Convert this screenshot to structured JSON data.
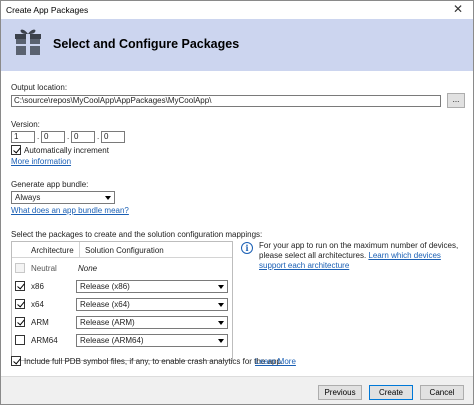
{
  "window": {
    "title": "Create App Packages",
    "close_glyph": "✕"
  },
  "header": {
    "title": "Select and Configure Packages",
    "icon": "package-icon"
  },
  "output": {
    "label": "Output location:",
    "value": "C:\\source\\repos\\MyCoolApp\\AppPackages\\MyCoolApp\\",
    "browse_label": "..."
  },
  "version": {
    "label": "Version:",
    "parts": [
      "1",
      "0",
      "0",
      "0"
    ],
    "separator": ".",
    "auto_increment_label": "Automatically increment",
    "auto_increment_checked": true,
    "more_info_link": "More information"
  },
  "bundle": {
    "label": "Generate app bundle:",
    "selected": "Always",
    "link": "What does an app bundle mean?"
  },
  "packages": {
    "label": "Select the packages to create and the solution configuration mappings:",
    "columns": {
      "architecture": "Architecture",
      "configuration": "Solution Configuration"
    },
    "rows": [
      {
        "arch": "Neutral",
        "config": "None",
        "checked": false
      },
      {
        "arch": "x86",
        "config": "Release (x86)",
        "checked": true
      },
      {
        "arch": "x64",
        "config": "Release (x64)",
        "checked": true
      },
      {
        "arch": "ARM",
        "config": "Release (ARM)",
        "checked": true
      },
      {
        "arch": "ARM64",
        "config": "Release (ARM64)",
        "checked": false
      }
    ]
  },
  "info": {
    "text": "For your app to run on the maximum number of devices, please select all architectures.",
    "link": "Learn which devices support each architecture"
  },
  "pdb": {
    "label": "Include full PDB symbol files, if any, to enable crash analytics for the app.",
    "link": "Learn More",
    "checked": true
  },
  "footer": {
    "previous": "Previous",
    "create": "Create",
    "cancel": "Cancel"
  }
}
